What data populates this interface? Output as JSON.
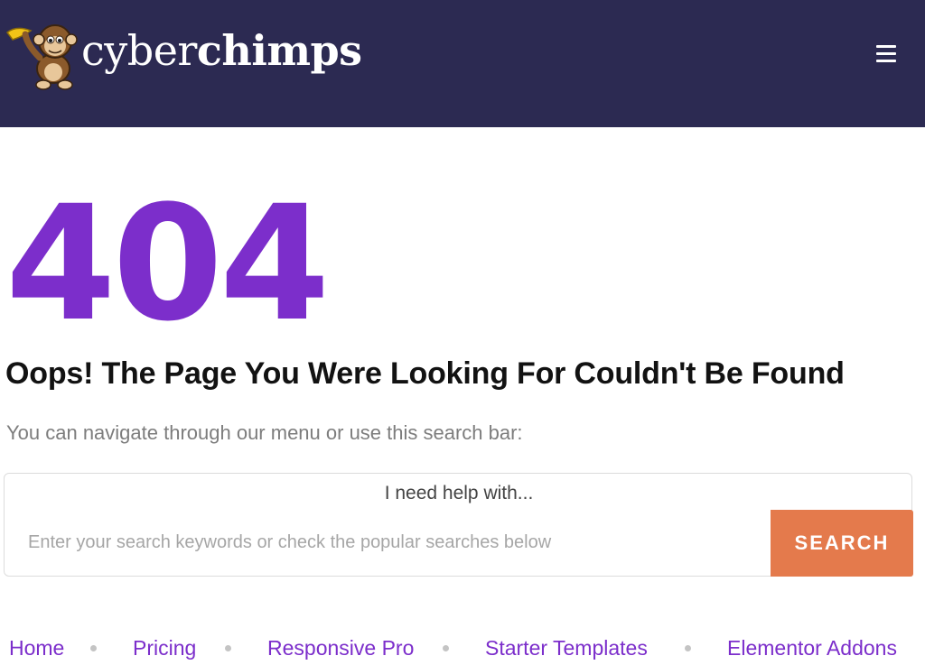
{
  "header": {
    "brand": {
      "part1": "cyber",
      "part2": "chimps"
    },
    "background_color": "#2c2a52",
    "menu_icon": "hamburger-icon"
  },
  "main": {
    "code": "404",
    "code_color": "#7c2ecb",
    "heading": "Oops! The Page You Were Looking For Couldn't Be Found",
    "subtext": "You can navigate through our menu or use this search bar:"
  },
  "search": {
    "label": "I need help with...",
    "placeholder": "Enter your search keywords or check the popular searches below",
    "value": "",
    "button_label": "SEARCH",
    "button_color": "#e47a4c"
  },
  "footer_nav": {
    "links": [
      {
        "label": "Home"
      },
      {
        "label": "Pricing"
      },
      {
        "label": "Responsive Pro"
      },
      {
        "label": "Starter Templates"
      },
      {
        "label": "Elementor Addons"
      }
    ],
    "link_color": "#7c2ecb"
  }
}
